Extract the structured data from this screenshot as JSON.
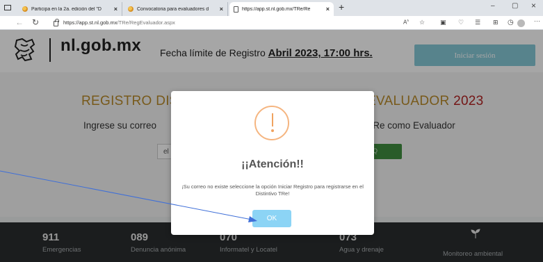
{
  "browser": {
    "tabs": [
      {
        "title": "Participa en la 2a. edición del \"D",
        "icon": "nl-favicon"
      },
      {
        "title": "Convocatoria para evaluadores d",
        "icon": "nl-favicon"
      },
      {
        "title": "https://app.st.nl.gob.mx/TRe/Re",
        "icon": "document-icon",
        "active": true
      }
    ],
    "close_glyph": "×",
    "new_tab_glyph": "+",
    "url_host": "https://app.st.nl.gob.mx",
    "url_path": "/TRe/RegEvaluador.aspx",
    "minimize_glyph": "–",
    "restore_glyph": "▢",
    "close_window_glyph": "×",
    "more_glyph": "···"
  },
  "header": {
    "site_name": "nl.gob.mx",
    "deadline_prefix": "Fecha límite de Registro ",
    "deadline_value": "Abril 2023, 17:00 hrs.",
    "login_label": "Iniciar sesión"
  },
  "hero": {
    "title_left": "REGISTRO DISTI",
    "title_right_prefix": "EVALUADOR ",
    "title_year": "2023",
    "subtitle_left": "Ingrese su correo",
    "subtitle_right": "TRe como Evaluador",
    "email_placeholder": "el",
    "search_glyph": "Q"
  },
  "footer": {
    "items": [
      {
        "number": "911",
        "label": "Emergencias"
      },
      {
        "number": "089",
        "label": "Denuncia anónima"
      },
      {
        "number": "070",
        "label": "Informatel y Locatel"
      },
      {
        "number": "073",
        "label": "Agua y drenaje"
      },
      {
        "number": "",
        "label": "Monitoreo ambiental"
      }
    ]
  },
  "modal": {
    "title": "¡¡Atención!!",
    "message": "¡Su correo no existe seleccione la opción Iniciar Registro para registrarse en el Distintivo TRe!",
    "ok_label": "OK"
  },
  "colors": {
    "accent_gold": "#b88a2a",
    "year_red": "#b22222",
    "login_button": "#86c9d8",
    "ok_button": "#8cd4f5",
    "warning": "#f5b580",
    "annotation_arrow": "#3f6fd8"
  }
}
